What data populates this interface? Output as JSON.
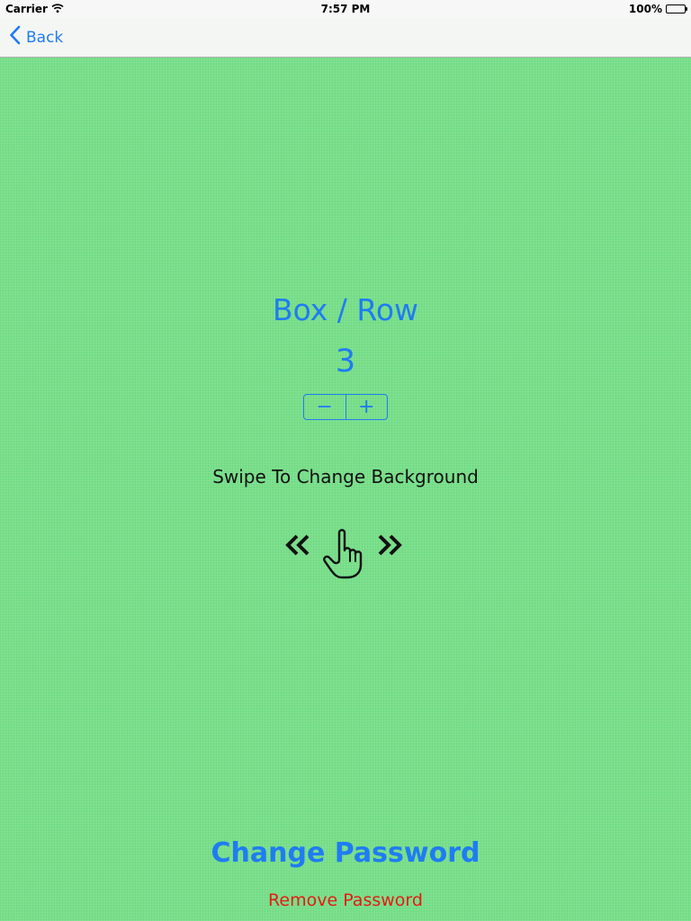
{
  "status_bar": {
    "carrier": "Carrier",
    "time": "7:57 PM",
    "battery": "100%",
    "battery_level": 1.0
  },
  "nav": {
    "back_label": "Back"
  },
  "settings": {
    "heading": "Box / Row",
    "count": "3",
    "minus_label": "−",
    "plus_label": "+",
    "swipe_hint": "Swipe To Change Background"
  },
  "actions": {
    "change_password": "Change Password",
    "remove_password": "Remove Password"
  },
  "icons": {
    "back": "chevron-left-icon",
    "wifi": "wifi-icon",
    "battery": "battery-icon",
    "swipe": "swipe-gesture-icon"
  },
  "colors": {
    "accent": "#1f7cf2",
    "destructive": "#e41b12",
    "background_green": "#78e08a"
  }
}
